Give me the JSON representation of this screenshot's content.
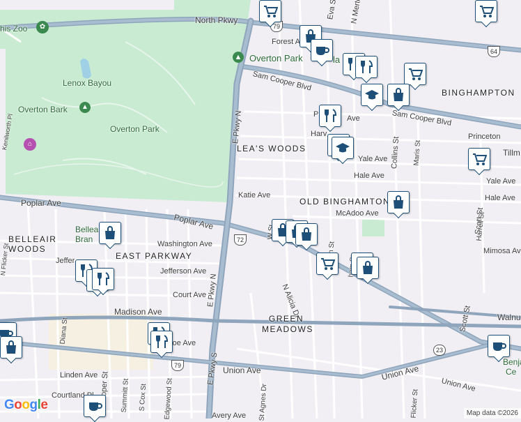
{
  "map": {
    "attribution": "Map data ©2026",
    "logo": "Google",
    "colors": {
      "park": "#c9ebd2",
      "highway": "#8fa5bc",
      "road": "#ffffff",
      "land": "#f1eff4",
      "poi_border": "#1d4f78"
    }
  },
  "labels": {
    "zoo": "his Zoo",
    "north_pkwy": "North Pkwy",
    "forest": "Forest A",
    "eva": "Eva St",
    "merton": "N Merto",
    "overton_park_poi": "Overton Park",
    "overton_park_poi2": "la",
    "lenox_bayou": "Lenox Bayou",
    "overton_bark": "Overton Bark",
    "overton_park": "Overton Park",
    "sam_cooper": "Sam Cooper Blvd",
    "sam_cooper2": "Sam Cooper Blvd",
    "binghampton": "BINGHAMPTON",
    "e_pkwy_n": "E Pkwy N",
    "e_pkwy_n2": "E Pkwy N",
    "kenilworth": "Kenilworth Pl",
    "leas_woods": "LEA'S WOODS",
    "pa_ave": "P",
    "ave": "Ave",
    "harv": "Harv",
    "collins": "Collins St",
    "maris": "Maris St",
    "princeton": "Princeton",
    "tillm": "Tillm",
    "yale": "Yale Ave",
    "yale2": "Yale Ave",
    "hale": "Hale Ave",
    "hale2": "Hale Ave",
    "katie": "Katie Ave",
    "old_binghampton": "OLD BINGHAMTON",
    "mcadoo": "McAdoo Ave",
    "poplar": "Poplar Ave",
    "poplar2": "Poplar Ave",
    "scott": "Scott St",
    "scott2": "Scott St",
    "harrell": "Harrell St",
    "mimosa": "Mimosa Ave",
    "belleair_woods": "BELLEAIR WOODS",
    "belleair_br": "Bellea",
    "belleair_br2": "Bran",
    "washington": "Washington Ave",
    "east_parkway": "EAST PARKWAY",
    "jefferson": "Jefferson Ave",
    "jeffer": "Jeffer",
    "flicker": "N Flicker St",
    "court": "Court Ave",
    "e_pkwy_n3": "E Pkwy N",
    "alicia": "N Alicia Dr",
    "orton": "rton St",
    "green_meadows": "GREEN MEADOWS",
    "madison": "Madison Ave",
    "walnu": "Walnu",
    "monroe": "roe Ave",
    "diana": "Diana St",
    "union": "Union Ave",
    "union2": "Union Ave",
    "union3": "Union Ave",
    "e_pkwy_s": "E Pkwy S",
    "linden": "Linden Ave",
    "cooper": "Cooper St",
    "summitt": "Summitt St",
    "scox": "S Cox St",
    "edgewood": "Edgewood St",
    "agnes": "St Agnes Dr",
    "courtland": "Courtland Pl",
    "avery": "Avery Ave",
    "flicker2": "Flicker St",
    "benja": "Benja",
    "ce": "Ce",
    "ham": "ham St",
    "w_st": "W St",
    "w_st2": "St"
  },
  "shields": {
    "us79a": "79",
    "us64": "64",
    "us72": "72",
    "us79b": "79",
    "r23": "23"
  },
  "pois": [
    {
      "name": "grocery-icon"
    },
    {
      "name": "shopping-bag-icon"
    },
    {
      "name": "grocery-icon"
    },
    {
      "name": "cafe-icon"
    },
    {
      "name": "restaurant-icon"
    },
    {
      "name": "restaurant-icon"
    },
    {
      "name": "grocery-icon"
    },
    {
      "name": "school-icon"
    },
    {
      "name": "shopping-bag-icon"
    },
    {
      "name": "restaurant-icon"
    },
    {
      "name": "school-icon"
    },
    {
      "name": "school-icon"
    },
    {
      "name": "grocery-icon"
    },
    {
      "name": "shopping-bag-icon"
    },
    {
      "name": "shopping-bag-icon"
    },
    {
      "name": "shopping-bag-icon"
    },
    {
      "name": "shopping-bag-icon"
    },
    {
      "name": "grocery-icon"
    },
    {
      "name": "shopping-bag-icon"
    },
    {
      "name": "shopping-bag-icon"
    },
    {
      "name": "shopping-bag-icon"
    },
    {
      "name": "restaurant-icon"
    },
    {
      "name": "restaurant-icon"
    },
    {
      "name": "restaurant-icon"
    },
    {
      "name": "cafe-icon"
    },
    {
      "name": "restaurant-icon"
    },
    {
      "name": "restaurant-icon"
    },
    {
      "name": "cafe-icon"
    },
    {
      "name": "shopping-bag-icon"
    },
    {
      "name": "cafe-icon"
    }
  ]
}
